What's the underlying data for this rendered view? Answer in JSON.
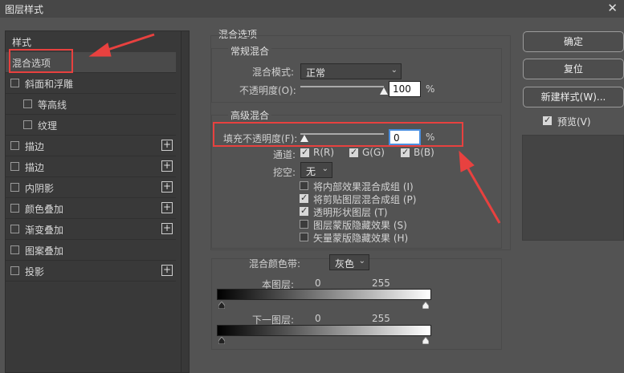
{
  "window": {
    "title": "图层样式",
    "close_glyph": "✕"
  },
  "left_panel": {
    "header": "样式",
    "items": [
      {
        "label": "混合选项",
        "checkbox": false,
        "checked": false,
        "plus": false,
        "selected": true
      },
      {
        "label": "斜面和浮雕",
        "checkbox": true,
        "checked": false,
        "plus": false
      },
      {
        "label": "等高线",
        "checkbox": true,
        "checked": false,
        "plus": false,
        "indent": true
      },
      {
        "label": "纹理",
        "checkbox": true,
        "checked": false,
        "plus": false,
        "indent": true
      },
      {
        "label": "描边",
        "checkbox": true,
        "checked": false,
        "plus": true
      },
      {
        "label": "描边",
        "checkbox": true,
        "checked": false,
        "plus": true
      },
      {
        "label": "内阴影",
        "checkbox": true,
        "checked": false,
        "plus": true
      },
      {
        "label": "颜色叠加",
        "checkbox": true,
        "checked": false,
        "plus": true
      },
      {
        "label": "渐变叠加",
        "checkbox": true,
        "checked": false,
        "plus": true
      },
      {
        "label": "图案叠加",
        "checkbox": true,
        "checked": false,
        "plus": false
      },
      {
        "label": "投影",
        "checkbox": true,
        "checked": false,
        "plus": true
      }
    ],
    "plus_glyph": "+"
  },
  "blend_options": {
    "title": "混合选项",
    "general": {
      "title": "常规混合",
      "mode_label": "混合模式:",
      "mode_value": "正常",
      "opacity_label": "不透明度(O):",
      "opacity_value": "100",
      "opacity_level": 1.0,
      "percent": "%"
    },
    "advanced": {
      "title": "高级混合",
      "fill_label": "填充不透明度(F):",
      "fill_value": "0",
      "fill_level": 0.0,
      "percent": "%",
      "channels_label": "通道:",
      "channels": [
        {
          "label": "R(R)",
          "checked": true
        },
        {
          "label": "G(G)",
          "checked": true
        },
        {
          "label": "B(B)",
          "checked": true
        }
      ],
      "knockout_label": "挖空:",
      "knockout_value": "无",
      "options": [
        {
          "label": "将内部效果混合成组 (I)",
          "checked": false
        },
        {
          "label": "将剪贴图层混合成组 (P)",
          "checked": true
        },
        {
          "label": "透明形状图层 (T)",
          "checked": true
        },
        {
          "label": "图层蒙版隐藏效果 (S)",
          "checked": false
        },
        {
          "label": "矢量蒙版隐藏效果 (H)",
          "checked": false
        }
      ]
    },
    "blend_if": {
      "label": "混合颜色带:",
      "value": "灰色",
      "this_layer_label": "本图层:",
      "this_layer_low": "0",
      "this_layer_high": "255",
      "underlying_label": "下一图层:",
      "underlying_low": "0",
      "underlying_high": "255"
    }
  },
  "right_panel": {
    "ok": "确定",
    "reset": "复位",
    "new_style": "新建样式(W)...",
    "preview_label": "预览(V)",
    "preview_checked": true
  },
  "colors": {
    "annotation_red": "#e8413f",
    "dialog_bg": "#535353",
    "panel_bg": "#393939"
  },
  "icons": {
    "dropdown": "chevron-down-icon"
  }
}
